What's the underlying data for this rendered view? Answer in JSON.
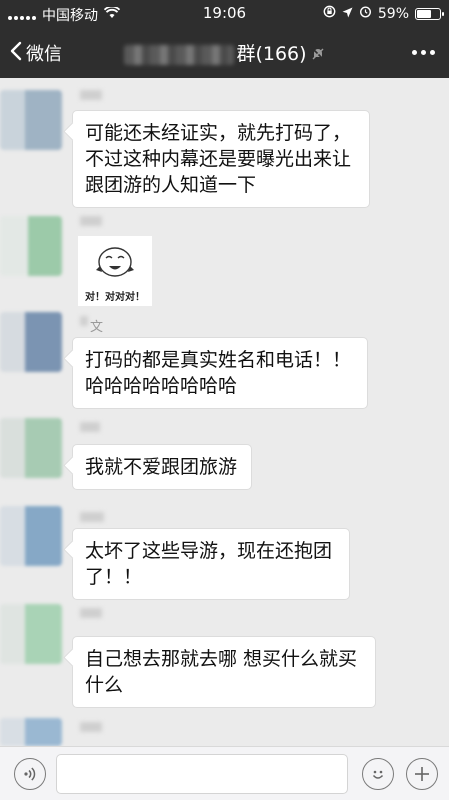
{
  "status_bar": {
    "carrier": "中国移动",
    "time": "19:06",
    "battery": "59%",
    "battery_level": 0.59
  },
  "nav": {
    "back_label": "微信",
    "title_suffix": "群(166)"
  },
  "messages": [
    {
      "type": "text",
      "text": "可能还未经证实，就先打码了，\n不过这种内幕还是要曝光出来让\n跟团游的人知道一下"
    },
    {
      "type": "sticker",
      "caption": "对！对对对！"
    },
    {
      "type": "text",
      "sender_fragment": "文",
      "text": "打码的都是真实姓名和电话！！\n哈哈哈哈哈哈哈哈"
    },
    {
      "type": "text",
      "text": "我就不爱跟团旅游"
    },
    {
      "type": "text",
      "text": "太坏了这些导游，现在还抱团\n了！！"
    },
    {
      "type": "text",
      "text": "自己想去那就去哪 想买什么就买\n什么"
    }
  ],
  "icons": {
    "status": [
      "signal-icon",
      "wifi-icon",
      "lock-rotation-icon",
      "location-icon",
      "alarm-icon",
      "battery-icon"
    ],
    "nav": [
      "back-chevron-icon",
      "mute-icon",
      "more-icon"
    ],
    "input": [
      "voice-icon",
      "emoji-icon",
      "plus-icon"
    ]
  }
}
